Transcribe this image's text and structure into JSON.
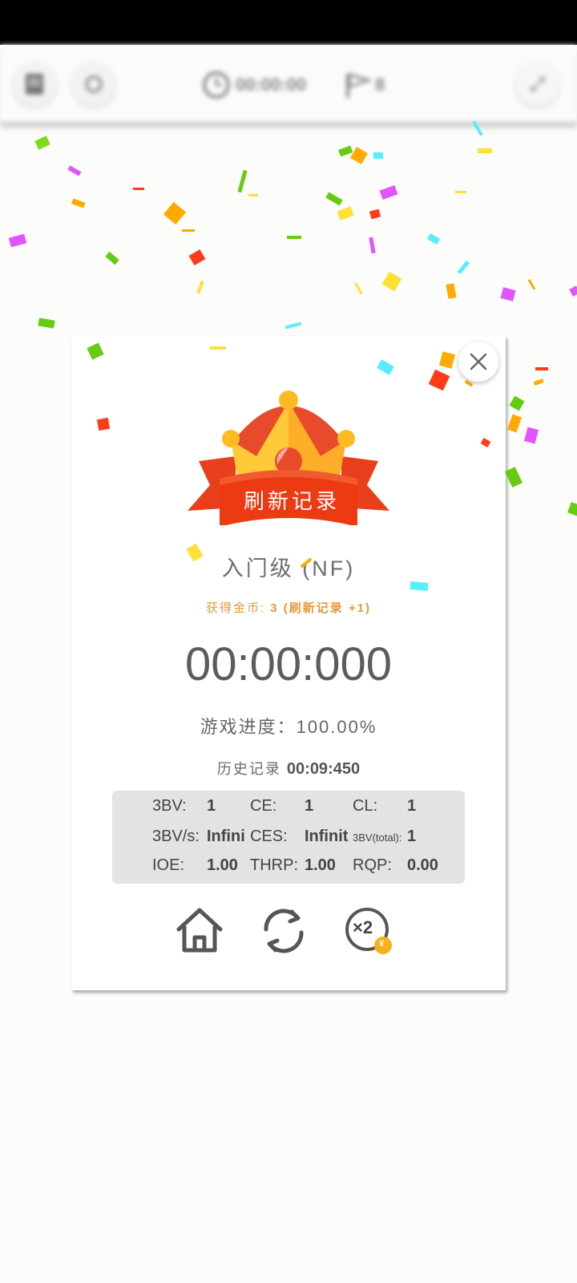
{
  "toolbar": {
    "timer": "00:00:00",
    "flag_count": "8"
  },
  "dialog": {
    "banner": "刷新记录",
    "level": "入门级 (NF)",
    "coins_label": "获得金币: ",
    "coins_value": "3 (刷新记录 +1)",
    "time": "00:00:000",
    "progress_label": "游戏进度：",
    "progress_value": "100.00%",
    "history_label": "历史记录 ",
    "history_value": "00:09:450",
    "stats": {
      "bv_label": "3BV:",
      "bv_value": "1",
      "ce_label": "CE:",
      "ce_value": "1",
      "cl_label": "CL:",
      "cl_value": "1",
      "bvs_label": "3BV/s:",
      "bvs_value": "Infini",
      "ces_label": "CES:",
      "ces_value": "Infinit",
      "bvtotal_label": "3BV(total):",
      "bvtotal_value": "1",
      "ioe_label": "IOE:",
      "ioe_value": "1.00",
      "thrp_label": "THRP:",
      "thrp_value": "1.00",
      "rqp_label": "RQP:",
      "rqp_value": "0.00"
    },
    "double_label": "×2",
    "coin_symbol": "¥"
  },
  "icons": {
    "home": "home-icon",
    "restart": "restart-icon",
    "double": "double-coins-icon",
    "close": "close-icon"
  },
  "colors": {
    "accent": "#e49a35",
    "banner_red": "#e8401c",
    "crown_gold": "#ffc93a"
  }
}
